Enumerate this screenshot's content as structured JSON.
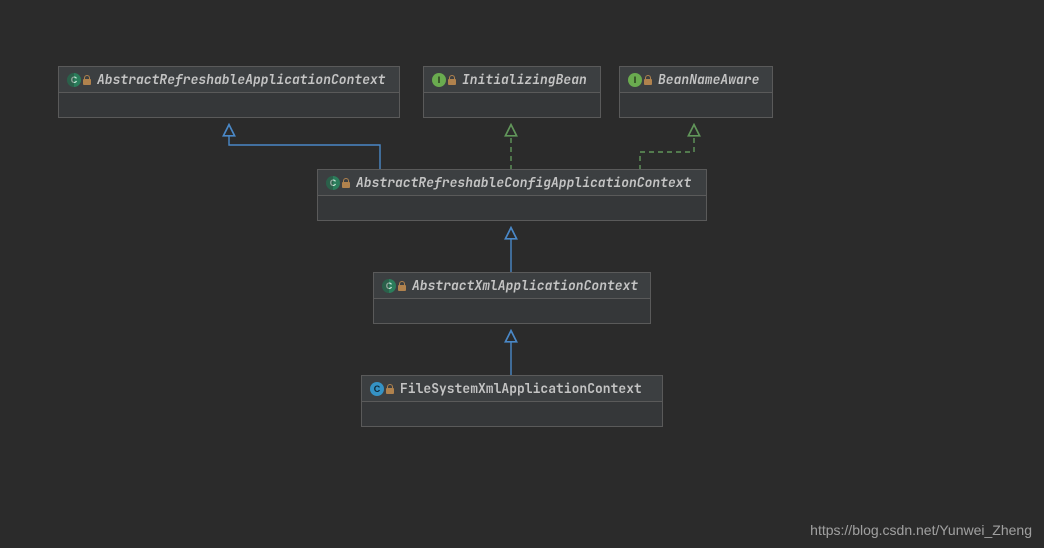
{
  "nodes": {
    "n1": {
      "name": "AbstractRefreshableApplicationContext",
      "kind": "abstract-class",
      "italic": true
    },
    "n2": {
      "name": "InitializingBean",
      "kind": "interface",
      "italic": true
    },
    "n3": {
      "name": "BeanNameAware",
      "kind": "interface",
      "italic": true
    },
    "n4": {
      "name": "AbstractRefreshableConfigApplicationContext",
      "kind": "abstract-class",
      "italic": true
    },
    "n5": {
      "name": "AbstractXmlApplicationContext",
      "kind": "abstract-class",
      "italic": true
    },
    "n6": {
      "name": "FileSystemXmlApplicationContext",
      "kind": "concrete-class",
      "italic": false
    }
  },
  "edges": [
    {
      "from": "n4",
      "to": "n1",
      "type": "extends"
    },
    {
      "from": "n4",
      "to": "n2",
      "type": "implements"
    },
    {
      "from": "n4",
      "to": "n3",
      "type": "implements"
    },
    {
      "from": "n5",
      "to": "n4",
      "type": "extends"
    },
    {
      "from": "n6",
      "to": "n5",
      "type": "extends"
    }
  ],
  "watermark": "https://blog.csdn.net/Yunwei_Zheng",
  "chart_data": {
    "type": "diagram",
    "title": "",
    "description": "UML class hierarchy",
    "nodes": [
      {
        "id": "n1",
        "label": "AbstractRefreshableApplicationContext",
        "stereotype": "abstract class"
      },
      {
        "id": "n2",
        "label": "InitializingBean",
        "stereotype": "interface"
      },
      {
        "id": "n3",
        "label": "BeanNameAware",
        "stereotype": "interface"
      },
      {
        "id": "n4",
        "label": "AbstractRefreshableConfigApplicationContext",
        "stereotype": "abstract class"
      },
      {
        "id": "n5",
        "label": "AbstractXmlApplicationContext",
        "stereotype": "abstract class"
      },
      {
        "id": "n6",
        "label": "FileSystemXmlApplicationContext",
        "stereotype": "class"
      }
    ],
    "edges": [
      {
        "from": "n4",
        "to": "n1",
        "relation": "extends"
      },
      {
        "from": "n4",
        "to": "n2",
        "relation": "implements"
      },
      {
        "from": "n4",
        "to": "n3",
        "relation": "implements"
      },
      {
        "from": "n5",
        "to": "n4",
        "relation": "extends"
      },
      {
        "from": "n6",
        "to": "n5",
        "relation": "extends"
      }
    ]
  }
}
